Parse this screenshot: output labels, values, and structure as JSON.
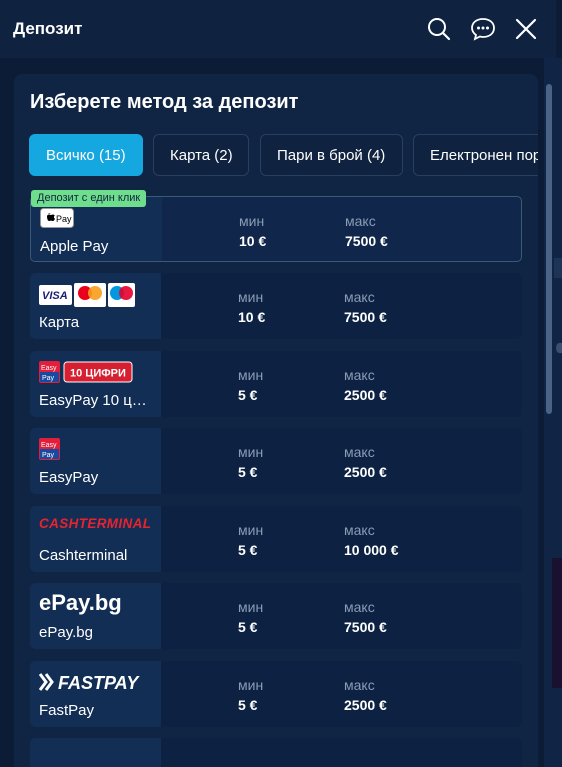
{
  "header": {
    "title": "Депозит"
  },
  "panel": {
    "heading": "Изберете метод за депозит"
  },
  "tabs": [
    {
      "label": "Всичко (15)"
    },
    {
      "label": "Карта (2)"
    },
    {
      "label": "Пари в брой (4)"
    },
    {
      "label": "Електронен портфейл"
    }
  ],
  "methods": [
    {
      "name": "Apple Pay",
      "min_label": "мин",
      "min": "10 €",
      "max_label": "макс",
      "max": "7500 €",
      "badge": "Депозит с един клик",
      "logo": "apple-pay-logo",
      "logo_text": "Pay"
    },
    {
      "name": "Карта",
      "min_label": "мин",
      "min": "10 €",
      "max_label": "макс",
      "max": "7500 €",
      "logo": "visa-mastercard-maestro-logo",
      "logo_text": "VISA"
    },
    {
      "name": "EasyPay 10 ц…",
      "min_label": "мин",
      "min": "5 €",
      "max_label": "макс",
      "max": "2500 €",
      "logo": "easypay-10-digits-logo",
      "logo_text": "10 ЦИФРИ",
      "logo_sub": "Easy Pay"
    },
    {
      "name": "EasyPay",
      "min_label": "мин",
      "min": "5 €",
      "max_label": "макс",
      "max": "2500 €",
      "logo": "easypay-logo",
      "logo_sub": "Easy Pay"
    },
    {
      "name": "Cashterminal",
      "min_label": "мин",
      "min": "5 €",
      "max_label": "макс",
      "max": "10 000 €",
      "logo": "cashterminal-logo",
      "logo_text": "CASHTERMINAL"
    },
    {
      "name": "ePay.bg",
      "min_label": "мин",
      "min": "5 €",
      "max_label": "макс",
      "max": "7500 €",
      "logo": "epay-logo",
      "logo_text": "ePay.bg"
    },
    {
      "name": "FastPay",
      "min_label": "мин",
      "min": "5 €",
      "max_label": "макс",
      "max": "2500 €",
      "logo": "fastpay-logo",
      "logo_text": "FASTPAY"
    }
  ],
  "colors": {
    "accent": "#15a7df",
    "badge": "#6fde8c",
    "background": "#0c1c36",
    "panel": "#102443"
  }
}
